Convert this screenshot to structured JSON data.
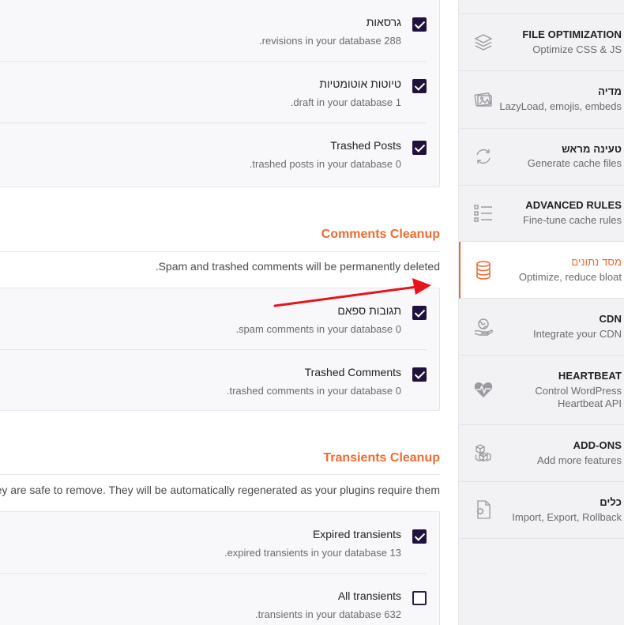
{
  "posts_cleanup": {
    "rows": [
      {
        "title": "גרסאות",
        "desc": ".revisions in your database 288",
        "checked": true
      },
      {
        "title": "טיוטות אוטומטיות",
        "desc": ".draft in your database 1",
        "checked": true
      },
      {
        "title": "Trashed Posts",
        "desc": ".trashed posts in your database 0",
        "checked": true
      }
    ]
  },
  "comments_cleanup": {
    "title": "Comments Cleanup",
    "desc": ".Spam and trashed comments will be permanently deleted",
    "rows": [
      {
        "title": "תגובות ספאם",
        "desc": ".spam comments in your database 0",
        "checked": true
      },
      {
        "title": "Trashed Comments",
        "desc": ".trashed comments in your database 0",
        "checked": true
      }
    ]
  },
  "transients_cleanup": {
    "title": "Transients Cleanup",
    "desc": "ey are safe to remove. They will be automatically regenerated as your plugins require them",
    "rows": [
      {
        "title": "Expired transients",
        "desc": ".expired transients in your database 13",
        "checked": true
      },
      {
        "title": "All transients",
        "desc": ".transients in your database 632",
        "checked": false
      }
    ]
  },
  "sidebar": {
    "items": [
      {
        "title": "FILE OPTIMIZATION",
        "sub": "Optimize CSS & JS",
        "icon": "layers-icon"
      },
      {
        "title": "מדיה",
        "sub": "LazyLoad, emojis, embeds",
        "icon": "images-icon"
      },
      {
        "title": "טעינה מראש",
        "sub": "Generate cache files",
        "icon": "refresh-icon"
      },
      {
        "title": "ADVANCED RULES",
        "sub": "Fine-tune cache rules",
        "icon": "list-icon"
      },
      {
        "title": "מסד נתונים",
        "sub": "Optimize, reduce bloat",
        "icon": "database-icon",
        "active": true
      },
      {
        "title": "CDN",
        "sub": "Integrate your CDN",
        "icon": "globe-hand-icon"
      },
      {
        "title": "HEARTBEAT",
        "sub_lines": [
          "Control WordPress",
          "Heartbeat API"
        ],
        "icon": "heartbeat-icon"
      },
      {
        "title": "ADD-ONS",
        "sub": "Add more features",
        "icon": "cubes-icon"
      },
      {
        "title": "כלים",
        "sub": "Import, Export, Rollback",
        "icon": "file-gear-icon"
      }
    ]
  },
  "colors": {
    "accent": "#ee6a2f",
    "checkbox": "#20123a",
    "annotation_arrow": "#e8141b"
  }
}
